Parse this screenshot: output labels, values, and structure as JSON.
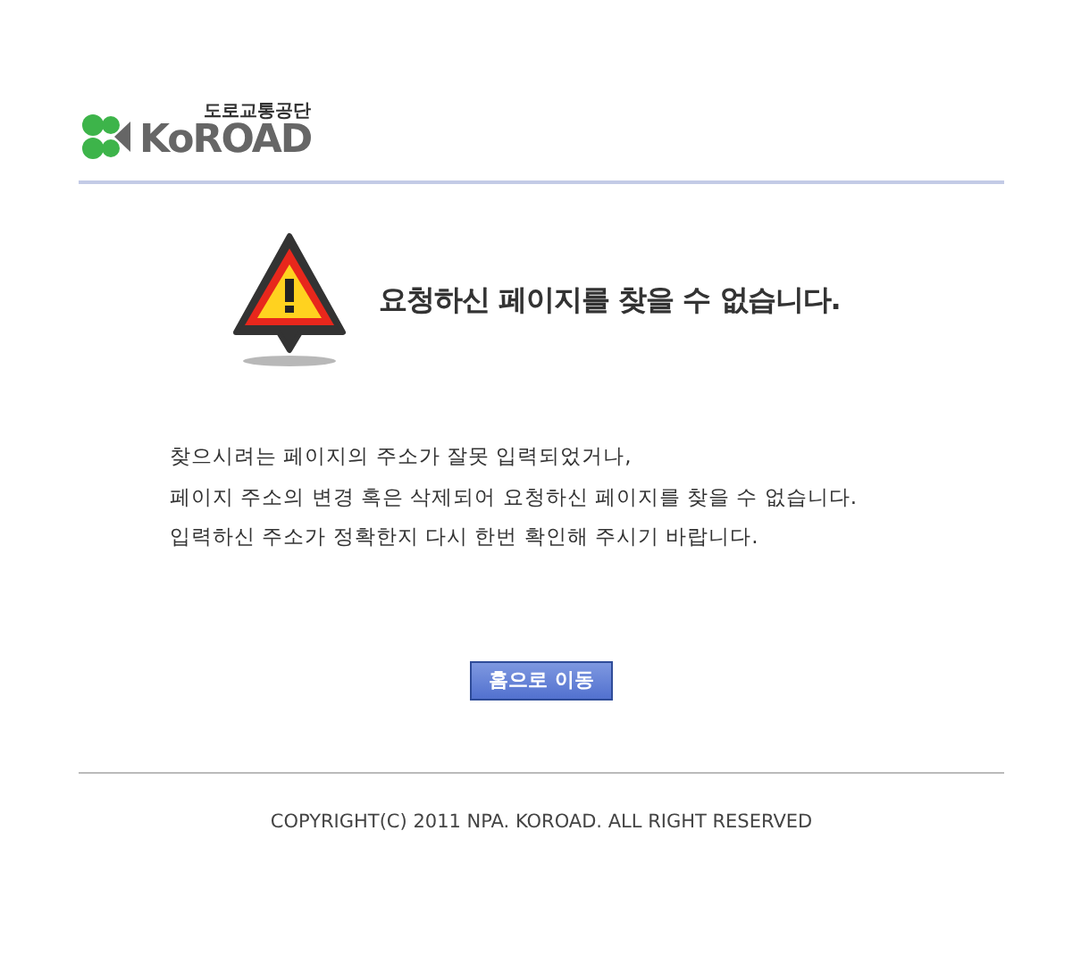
{
  "logo": {
    "subtitle": "도로교통공단",
    "name": "KoROAD"
  },
  "heading": "요청하신 페이지를 찾을 수 없습니다.",
  "message_lines": [
    "찾으시려는 페이지의 주소가 잘못 입력되었거나,",
    "페이지 주소의 변경 혹은 삭제되어 요청하신 페이지를 찾을 수 없습니다.",
    "입력하신 주소가 정확한지 다시 한번 확인해 주시기 바랍니다."
  ],
  "home_button": "홈으로 이동",
  "copyright": "COPYRIGHT(C) 2011 NPA. KOROAD. ALL RIGHT RESERVED"
}
